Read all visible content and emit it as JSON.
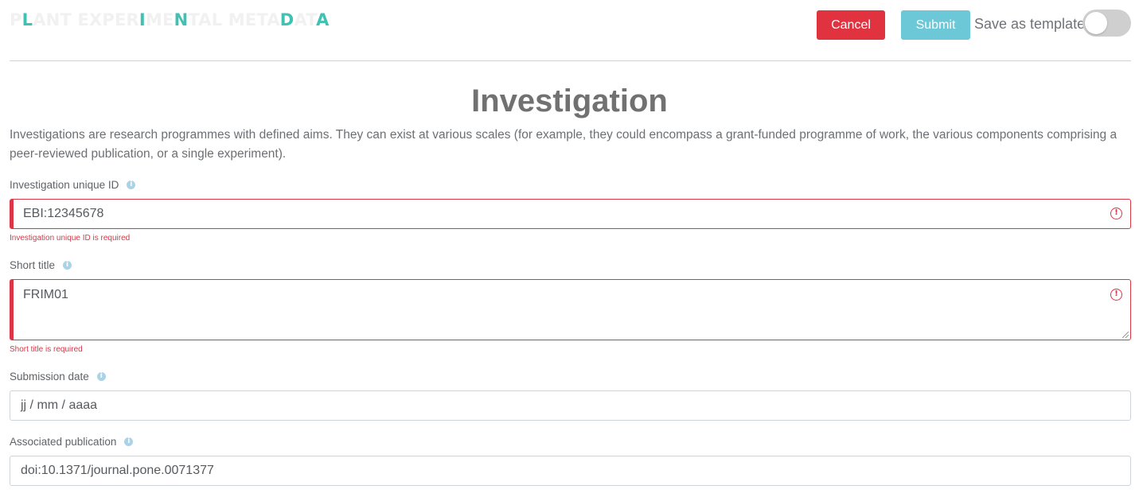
{
  "header": {
    "logo": {
      "p1": "P",
      "hl1": "L",
      "p2": "ANT EXPER",
      "hl2": "I",
      "p3": "ME",
      "hl3": "N",
      "p4": "TAL META",
      "hl4": "D",
      "p5": "AT",
      "hl5": "A"
    },
    "cancel_label": "Cancel",
    "submit_label": "Submit",
    "template_label": "Save as template",
    "template_toggle_on": false
  },
  "colors": {
    "cancel": "#e0323f",
    "submit": "#6cc7d7",
    "logo_accent": "#3fc1b3",
    "error": "#dc3545"
  },
  "main": {
    "title": "Investigation",
    "description": "Investigations are research programmes with defined aims. They can exist at various scales (for example, they could encompass a grant-funded programme of work, the various components comprising a peer-reviewed publication, or a single experiment).",
    "fields": [
      {
        "label": "Investigation unique ID",
        "value": "EBI:12345678",
        "error": "Investigation unique ID is required",
        "icon": "info-icon"
      },
      {
        "label": "Short title",
        "value": "FRIM01",
        "error": "Short title is required",
        "icon": "info-icon"
      },
      {
        "label": "Submission date",
        "value": "jj / mm / aaaa",
        "icon": "info-icon"
      },
      {
        "label": "Associated publication",
        "value": "doi:10.1371/journal.pone.0071377",
        "icon": "info-icon"
      }
    ]
  }
}
